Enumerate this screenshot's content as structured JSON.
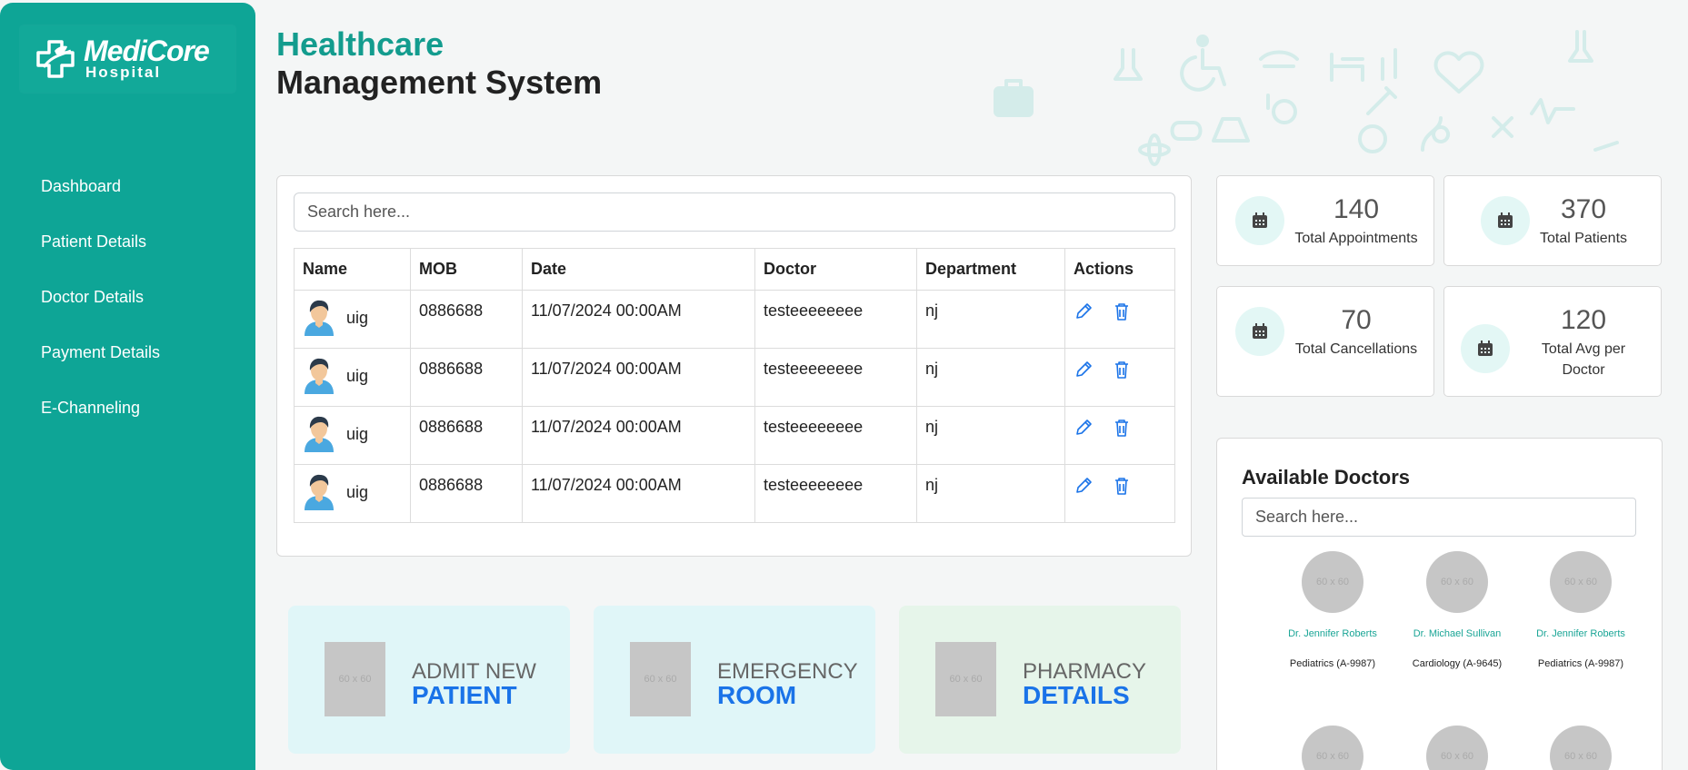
{
  "brand": {
    "name": "MediCore",
    "sub": "Hospital",
    "color": "#0ea596"
  },
  "header": {
    "title_line1": "Healthcare",
    "title_line2": "Management System"
  },
  "nav": [
    "Dashboard",
    "Patient Details",
    "Doctor Details",
    "Payment Details",
    "E-Channeling"
  ],
  "table": {
    "search_placeholder": "Search here...",
    "columns": [
      "Name",
      "MOB",
      "Date",
      "Doctor",
      "Department",
      "Actions"
    ],
    "rows": [
      {
        "name": "uig",
        "mob": "0886688",
        "date": "11/07/2024 00:00AM",
        "doctor": "testeeeeeeee",
        "department": "nj"
      },
      {
        "name": "uig",
        "mob": "0886688",
        "date": "11/07/2024 00:00AM",
        "doctor": "testeeeeeeee",
        "department": "nj"
      },
      {
        "name": "uig",
        "mob": "0886688",
        "date": "11/07/2024 00:00AM",
        "doctor": "testeeeeeeee",
        "department": "nj"
      },
      {
        "name": "uig",
        "mob": "0886688",
        "date": "11/07/2024 00:00AM",
        "doctor": "testeeeeeeee",
        "department": "nj"
      }
    ],
    "row_actions": [
      "edit-icon",
      "trash-icon"
    ]
  },
  "stats": [
    {
      "value": "140",
      "label": "Total Appointments",
      "icon": "calendar-icon"
    },
    {
      "value": "370",
      "label": "Total Patients",
      "icon": "calendar-icon"
    },
    {
      "value": "70",
      "label": "Total Cancellations",
      "icon": "calendar-icon"
    },
    {
      "value": "120",
      "label": "Total Avg per Doctor",
      "icon": "calendar-icon"
    }
  ],
  "doctors": {
    "title": "Available Doctors",
    "search_placeholder": "Search here...",
    "photo_placeholder": "60 x 60",
    "list": [
      {
        "name": "Dr. Jennifer Roberts",
        "dept": "Pediatrics (A-9987)"
      },
      {
        "name": "Dr. Michael Sullivan",
        "dept": "Cardiology (A-9645)"
      },
      {
        "name": "Dr. Jennifer Roberts",
        "dept": "Pediatrics (A-9987)"
      }
    ]
  },
  "tiles": [
    {
      "top": "ADMIT NEW",
      "bottom": "PATIENT",
      "bg": "#e0f6f8",
      "img": "60 x 60"
    },
    {
      "top": "EMERGENCY",
      "bottom": "ROOM",
      "bg": "#e0f6f8",
      "img": "60 x 60"
    },
    {
      "top": "PHARMACY",
      "bottom": "DETAILS",
      "bg": "#e6f5ea",
      "img": "60 x 60"
    }
  ]
}
